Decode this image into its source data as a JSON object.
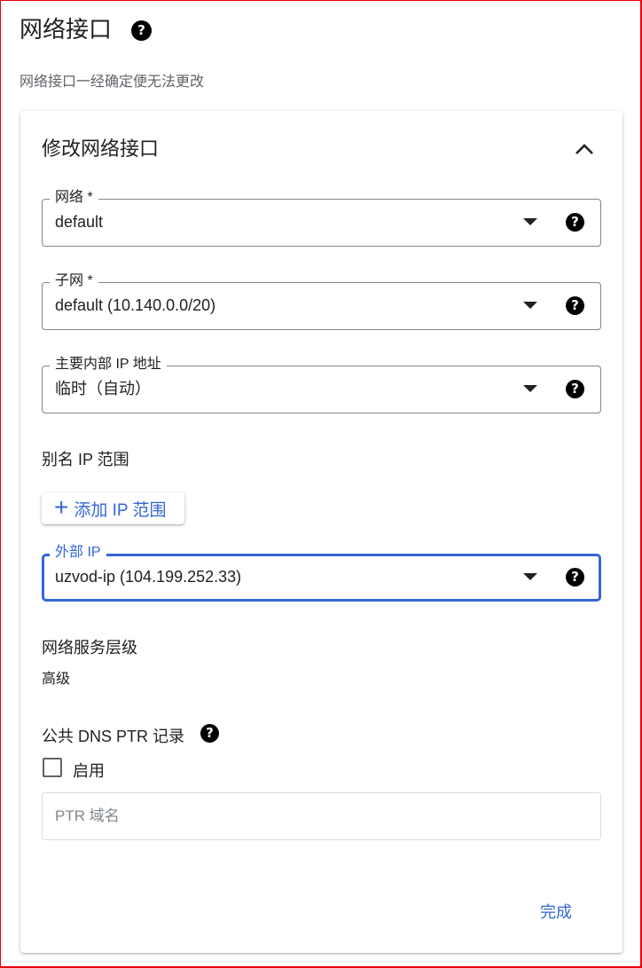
{
  "header": {
    "title": "网络接口",
    "subtitle": "网络接口一经确定便无法更改"
  },
  "card": {
    "title": "修改网络接口",
    "collapse_icon": "chevron-up-icon"
  },
  "fields": {
    "network": {
      "label": "网络 *",
      "value": "default"
    },
    "subnet": {
      "label": "子网 *",
      "value": "default (10.140.0.0/20)"
    },
    "primary_ip": {
      "label": "主要内部 IP 地址",
      "value": "临时（自动）"
    },
    "external_ip": {
      "label": "外部 IP",
      "value": "uzvod-ip (104.199.252.33)"
    }
  },
  "alias": {
    "label": "别名 IP 范围",
    "add_button": "添加 IP 范围"
  },
  "tier": {
    "label": "网络服务层级",
    "value": "高级"
  },
  "dns": {
    "label": "公共 DNS PTR 记录",
    "checkbox_label": "启用",
    "checked": false,
    "ptr_placeholder": "PTR 域名"
  },
  "actions": {
    "done": "完成"
  },
  "colors": {
    "accent": "#3367d6",
    "frame": "#e8000b"
  }
}
